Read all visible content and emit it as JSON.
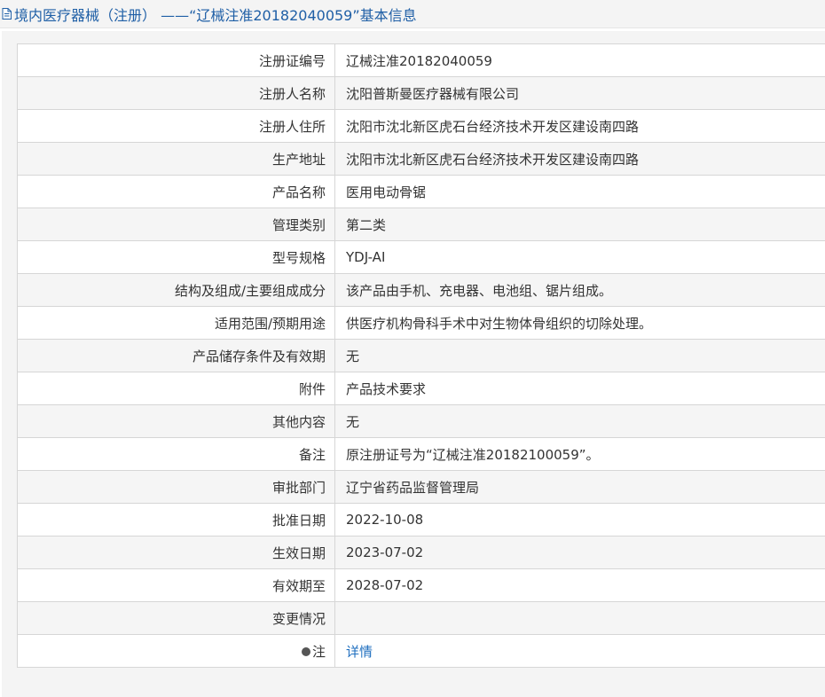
{
  "header": {
    "title": "境内医疗器械（注册） ——“辽械注准20182040059”基本信息",
    "icon": "document-icon"
  },
  "colors": {
    "title": "#1f5fa6",
    "link": "#1f6fbf",
    "row_alt": "#f5f5f5",
    "border": "#d6d6d6"
  },
  "rows": [
    {
      "label": "注册证编号",
      "value": "辽械注准20182040059"
    },
    {
      "label": "注册人名称",
      "value": "沈阳普斯曼医疗器械有限公司"
    },
    {
      "label": "注册人住所",
      "value": "沈阳市沈北新区虎石台经济技术开发区建设南四路"
    },
    {
      "label": "生产地址",
      "value": "沈阳市沈北新区虎石台经济技术开发区建设南四路"
    },
    {
      "label": "产品名称",
      "value": "医用电动骨锯"
    },
    {
      "label": "管理类别",
      "value": "第二类"
    },
    {
      "label": "型号规格",
      "value": "YDJ-AⅠ"
    },
    {
      "label": "结构及组成/主要组成成分",
      "value": "该产品由手机、充电器、电池组、锯片组成。"
    },
    {
      "label": "适用范围/预期用途",
      "value": "供医疗机构骨科手术中对生物体骨组织的切除处理。"
    },
    {
      "label": "产品储存条件及有效期",
      "value": "无"
    },
    {
      "label": "附件",
      "value": "产品技术要求"
    },
    {
      "label": "其他内容",
      "value": "无"
    },
    {
      "label": "备注",
      "value": "原注册证号为“辽械注准20182100059”。"
    },
    {
      "label": "审批部门",
      "value": "辽宁省药品监督管理局"
    },
    {
      "label": "批准日期",
      "value": "2022-10-08"
    },
    {
      "label": "生效日期",
      "value": "2023-07-02"
    },
    {
      "label": "有效期至",
      "value": "2028-07-02"
    },
    {
      "label": "变更情况",
      "value": ""
    }
  ],
  "note": {
    "label": "注",
    "icon": "lightbulb-icon",
    "link_text": "详情"
  }
}
